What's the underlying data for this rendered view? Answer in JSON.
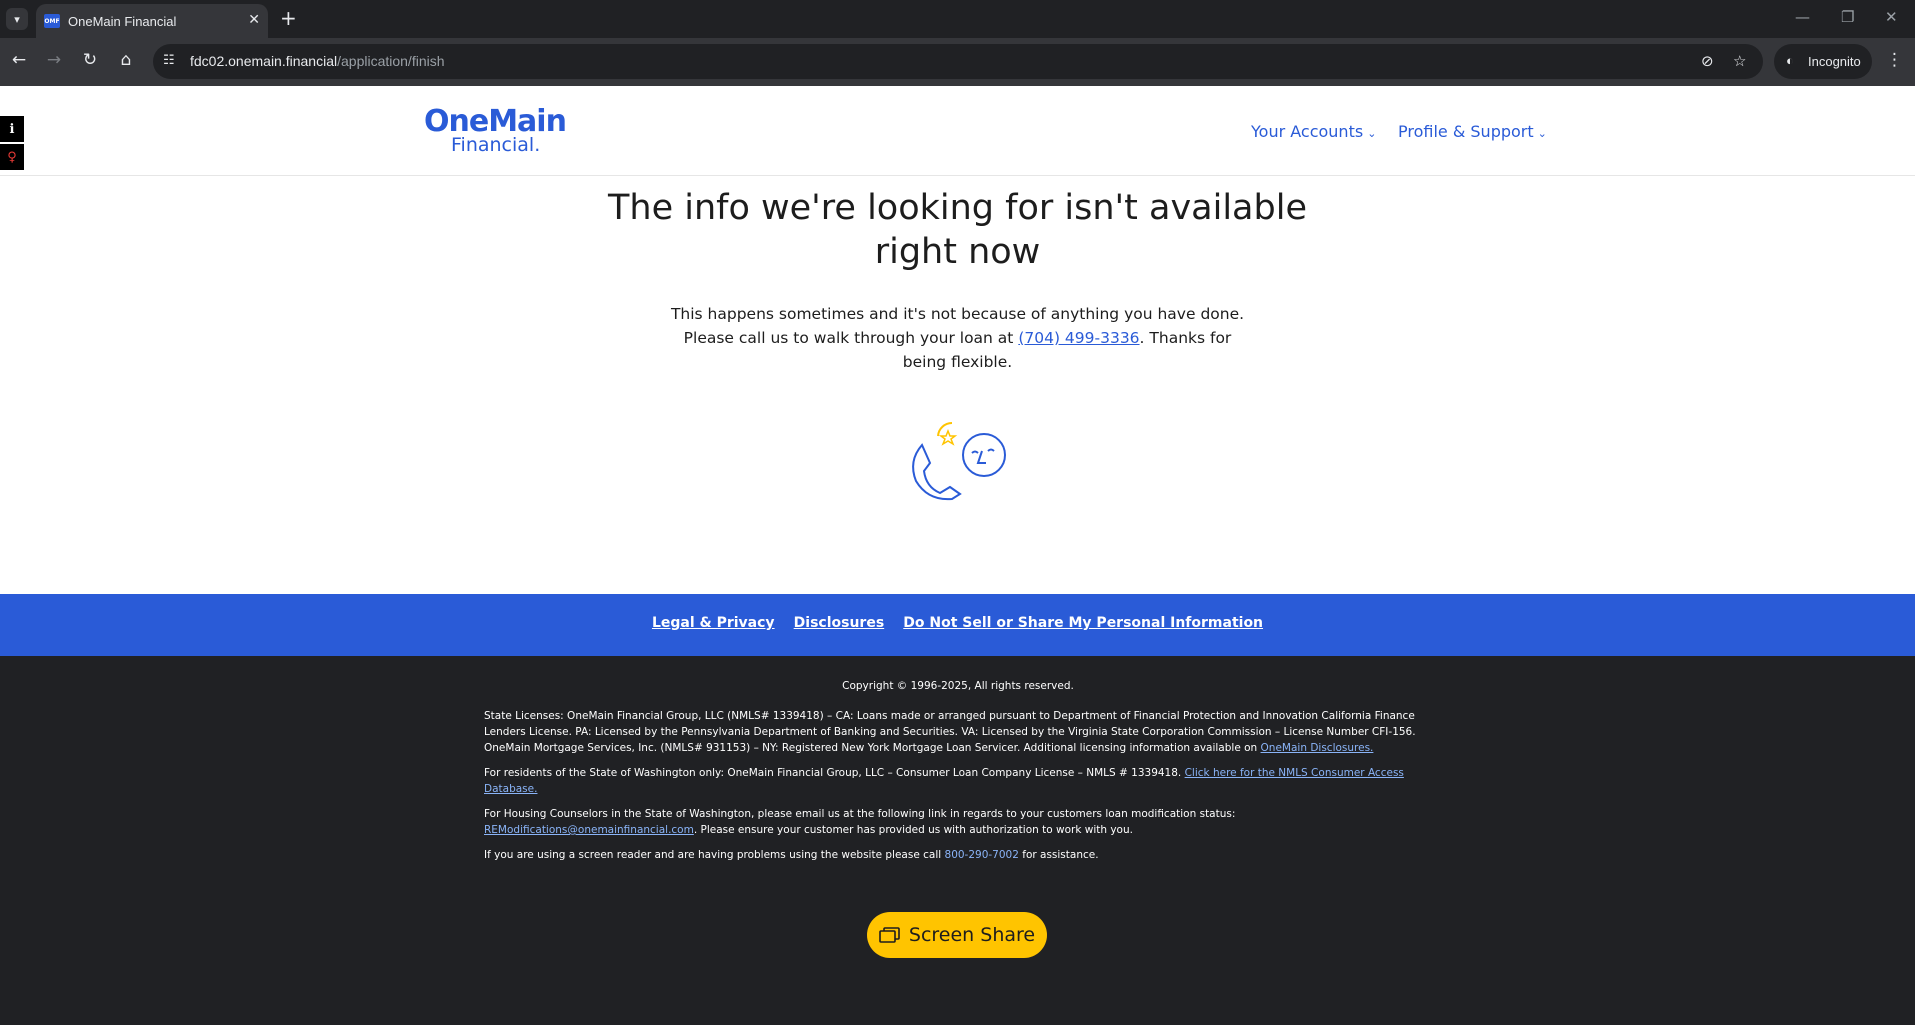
{
  "browser": {
    "tab_title": "OneMain Financial",
    "favicon_text": "OMF",
    "url_host": "fdc02.onemain.financial",
    "url_path": "/application/finish",
    "incognito_label": "Incognito"
  },
  "header": {
    "logo_top": "OneMain",
    "logo_bottom": "Financial.",
    "nav": [
      {
        "label": "Your Accounts"
      },
      {
        "label": "Profile & Support"
      }
    ]
  },
  "main": {
    "title": "The info we're looking for isn't available right now",
    "body_before": "This happens sometimes and it's not because of anything you have done. Please call us to walk through your loan at ",
    "phone": "(704) 499-3336",
    "body_after": ". Thanks for being flexible."
  },
  "footer_links": [
    {
      "label": "Legal & Privacy"
    },
    {
      "label": "Disclosures"
    },
    {
      "label": "Do Not Sell or Share My Personal Information"
    }
  ],
  "footer": {
    "copyright": "Copyright © 1996-2025, All rights reserved.",
    "licenses_text": "State Licenses: OneMain Financial Group, LLC (NMLS# 1339418) – CA: Loans made or arranged pursuant to Department of Financial Protection and Innovation California Finance Lenders License. PA: Licensed by the Pennsylvania Department of Banking and Securities. VA: Licensed by the Virginia State Corporation Commission – License Number CFI-156. OneMain Mortgage Services, Inc. (NMLS# 931153) – NY: Registered New York Mortgage Loan Servicer. Additional licensing information available on ",
    "licenses_link": "OneMain Disclosures.",
    "washington_text": "For residents of the State of Washington only: OneMain Financial Group, LLC – Consumer Loan Company License – NMLS # 1339418. ",
    "washington_link": "Click here for the NMLS Consumer Access Database.",
    "housing_text": "For Housing Counselors in the State of Washington, please email us at the following link in regards to your customers loan modification status: ",
    "housing_link": "REModifications@onemainfinancial.com",
    "housing_after": ". Please ensure your customer has provided us with authorization to work with you.",
    "screenreader_before": "If you are using a screen reader and are having problems using the website please call ",
    "screenreader_phone": "800-290-7002",
    "screenreader_after": " for assistance.",
    "screen_share_label": "Screen Share"
  },
  "colors": {
    "brand_blue": "#2a5bd7",
    "footer_dark": "#202124",
    "screen_share_yellow": "#ffc400"
  }
}
